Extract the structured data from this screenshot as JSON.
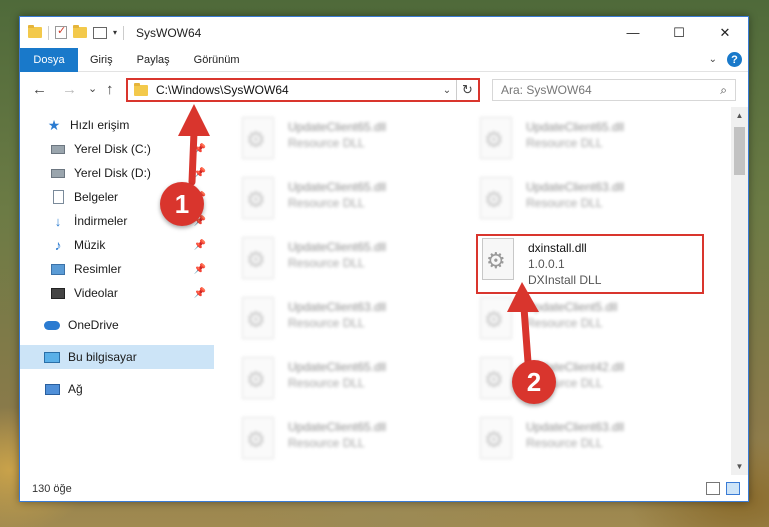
{
  "window": {
    "title": "SysWOW64",
    "controls": {
      "minimize": "—",
      "maximize": "☐",
      "close": "✕"
    }
  },
  "ribbon": {
    "tabs": [
      {
        "label": "Dosya"
      },
      {
        "label": "Giriş"
      },
      {
        "label": "Paylaş"
      },
      {
        "label": "Görünüm"
      }
    ],
    "help": "?"
  },
  "navigation": {
    "back": "←",
    "forward": "→",
    "recent": "⌄",
    "up": "↑",
    "address": "C:\\Windows\\SysWOW64",
    "search_placeholder": "Ara: SysWOW64"
  },
  "sidebar": {
    "items": [
      {
        "label": "Hızlı erişim",
        "icon": "star-icon"
      },
      {
        "label": "Yerel Disk (C:)",
        "icon": "drive-icon",
        "pinned": true
      },
      {
        "label": "Yerel Disk (D:)",
        "icon": "drive-icon",
        "pinned": true
      },
      {
        "label": "Belgeler",
        "icon": "documents-icon",
        "pinned": true
      },
      {
        "label": "İndirmeler",
        "icon": "download-icon",
        "pinned": true
      },
      {
        "label": "Müzik",
        "icon": "music-icon",
        "pinned": true
      },
      {
        "label": "Resimler",
        "icon": "pictures-icon",
        "pinned": true
      },
      {
        "label": "Videolar",
        "icon": "videos-icon",
        "pinned": true
      },
      {
        "label": "OneDrive",
        "icon": "onedrive-icon"
      },
      {
        "label": "Bu bilgisayar",
        "icon": "computer-icon",
        "selected": true
      },
      {
        "label": "Ağ",
        "icon": "network-icon"
      }
    ]
  },
  "files": [
    {
      "name": "UpdateClient65.dll",
      "type": "Resource DLL"
    },
    {
      "name": "UpdateClient65.dll",
      "type": "Resource DLL"
    },
    {
      "name": "UpdateClient65.dll",
      "type": "Resource DLL"
    },
    {
      "name": "UpdateClient63.dll",
      "type": "Resource DLL"
    },
    {
      "name": "UpdateClient65.dll",
      "type": "Resource DLL"
    },
    {
      "name": "dxinstall.dll",
      "version": "1.0.0.1",
      "type": "DXInstall DLL"
    },
    {
      "name": "UpdateClient63.dll",
      "type": "Resource DLL"
    },
    {
      "name": "UpdateClient5.dll",
      "type": "Resource DLL"
    },
    {
      "name": "UpdateClient65.dll",
      "type": "Resource DLL"
    },
    {
      "name": "UpdateClient42.dll",
      "type": "Resource DLL"
    },
    {
      "name": "UpdateClient65.dll",
      "type": "Resource DLL"
    },
    {
      "name": "UpdateClient63.dll",
      "type": "Resource DLL"
    }
  ],
  "status": {
    "count": "130 öğe"
  },
  "annotations": {
    "step1": "1",
    "step2": "2",
    "color": "#d9352d"
  }
}
